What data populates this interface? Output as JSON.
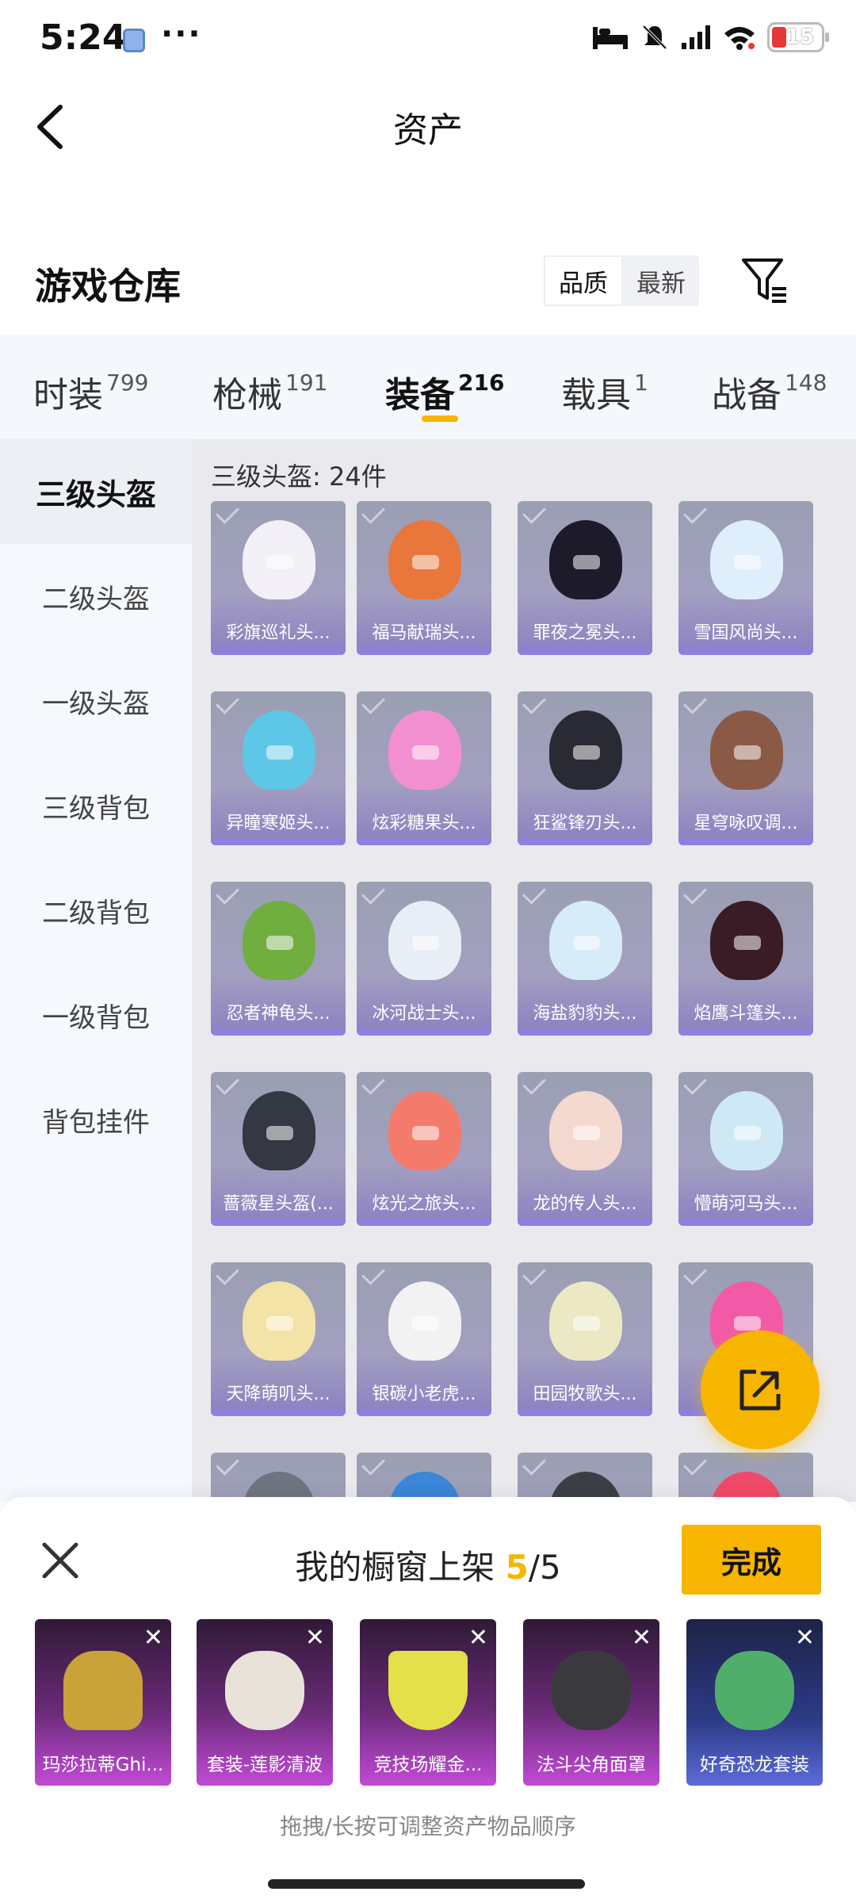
{
  "status_bar": {
    "time": "5:24",
    "battery": "15",
    "icons": [
      "bed-icon",
      "mute-icon",
      "signal-icon",
      "wifi-icon",
      "battery-icon"
    ]
  },
  "header": {
    "title": "资产"
  },
  "warehouse": {
    "title": "游戏仓库",
    "sort": [
      "品质",
      "最新"
    ]
  },
  "categories": [
    {
      "label": "时装",
      "count": "799"
    },
    {
      "label": "枪械",
      "count": "191"
    },
    {
      "label": "装备",
      "count": "216"
    },
    {
      "label": "载具",
      "count": "1"
    },
    {
      "label": "战备",
      "count": "148"
    }
  ],
  "sidebar": [
    {
      "label": "三级头盔"
    },
    {
      "label": "二级头盔"
    },
    {
      "label": "一级头盔"
    },
    {
      "label": "三级背包"
    },
    {
      "label": "二级背包"
    },
    {
      "label": "一级背包"
    },
    {
      "label": "背包挂件"
    }
  ],
  "grid": {
    "header": "三级头盔: 24件",
    "items": [
      {
        "name": "彩旗巡礼头...",
        "color": "#f2f0f6"
      },
      {
        "name": "福马献瑞头...",
        "color": "#e9763b"
      },
      {
        "name": "罪夜之冕头...",
        "color": "#1d1a2a"
      },
      {
        "name": "雪国风尚头...",
        "color": "#dfeefb"
      },
      {
        "name": "异瞳寒姬头...",
        "color": "#5ec6e6"
      },
      {
        "name": "炫彩糖果头...",
        "color": "#f28fd0"
      },
      {
        "name": "狂鲨锋刃头...",
        "color": "#2a2a35"
      },
      {
        "name": "星穹咏叹调...",
        "color": "#8a5a46"
      },
      {
        "name": "忍者神龟头...",
        "color": "#6fae3f"
      },
      {
        "name": "冰河战士头...",
        "color": "#e8eef6"
      },
      {
        "name": "海盐豹豹头...",
        "color": "#d6ecf9"
      },
      {
        "name": "焰鹰斗篷头...",
        "color": "#3a1c26"
      },
      {
        "name": "蔷薇星头盔(...",
        "color": "#333842"
      },
      {
        "name": "炫光之旅头...",
        "color": "#f47b6b"
      },
      {
        "name": "龙的传人头...",
        "color": "#f3d9d0"
      },
      {
        "name": "懵萌河马头...",
        "color": "#cfe8f6"
      },
      {
        "name": "天降萌叽头...",
        "color": "#f4e3a6"
      },
      {
        "name": "银碳小老虎...",
        "color": "#f2f2f2"
      },
      {
        "name": "田园牧歌头...",
        "color": "#ece8c4"
      },
      {
        "name": "",
        "color": "#f25aa8"
      },
      {
        "name": "",
        "color": "#6e7480"
      },
      {
        "name": "",
        "color": "#3b86d8"
      },
      {
        "name": "",
        "color": "#3b3f45"
      },
      {
        "name": "",
        "color": "#ef4a68"
      }
    ]
  },
  "fab": {
    "icon": "share-icon"
  },
  "showcase": {
    "title": "我的橱窗上架",
    "count_current": "5",
    "count_total": "/5",
    "done_label": "完成",
    "hint": "拖拽/长按可调整资产物品顺序",
    "items": [
      {
        "name": "玛莎拉蒂Ghi...",
        "theme": "purple",
        "art_color": "#c9a23a"
      },
      {
        "name": "套装-莲影清波",
        "theme": "purple",
        "art_color": "#e9e2d8"
      },
      {
        "name": "竞技场耀金...",
        "theme": "purple",
        "art_color": "#e4e04a"
      },
      {
        "name": "法斗尖角面罩",
        "theme": "purple",
        "art_color": "#3a3a3e"
      },
      {
        "name": "好奇恐龙套装",
        "theme": "blue",
        "art_color": "#4fae6a"
      }
    ]
  }
}
